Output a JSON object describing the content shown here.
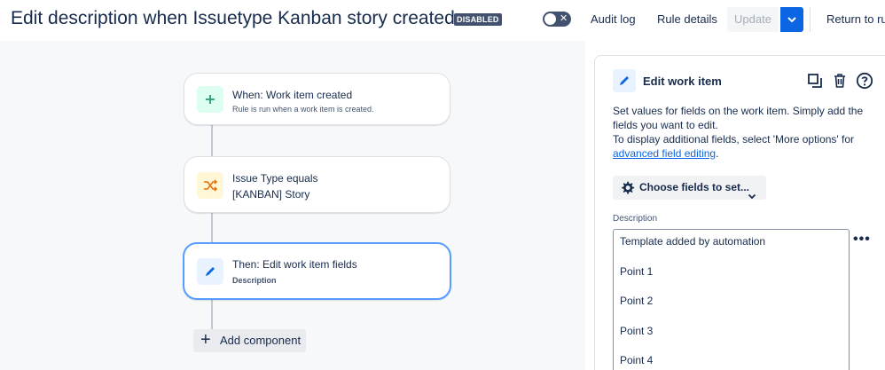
{
  "header": {
    "title": "Edit description when Issuetype Kanban story created",
    "status_badge": "DISABLED",
    "toggle_icon": "x-icon",
    "audit_log": "Audit log",
    "rule_details": "Rule details",
    "update": "Update",
    "return_label": "Return to rul"
  },
  "rule": {
    "trigger": {
      "title": "When: Work item created",
      "subtitle": "Rule is run when a work item is created.",
      "icon": "plus-icon",
      "color": "#22a06b"
    },
    "condition": {
      "title": "Issue Type equals",
      "subtitle": "[KANBAN] Story",
      "icon": "shuffle-icon",
      "color": "#e2740d"
    },
    "action": {
      "title": "Then: Edit work item fields",
      "subtitle": "Description",
      "icon": "pencil-icon",
      "color": "#0c66e4"
    },
    "add_component": "Add component"
  },
  "panel": {
    "title": "Edit work item",
    "description_line1": "Set values for fields on the work item. Simply add the fields you want to edit.",
    "description_line2": "To display additional fields, select 'More options' for",
    "description_link": "advanced field editing",
    "description_end": ".",
    "choose_fields": "Choose fields to set...",
    "field_label": "Description",
    "field_lines": [
      "Template added by automation",
      "Point 1",
      "Point 2",
      "Point 3",
      "Point 4"
    ],
    "more_menu": "•••"
  },
  "colors": {
    "accent": "#0c66e4",
    "selected_border": "#579dff",
    "badge": "#42526e"
  }
}
